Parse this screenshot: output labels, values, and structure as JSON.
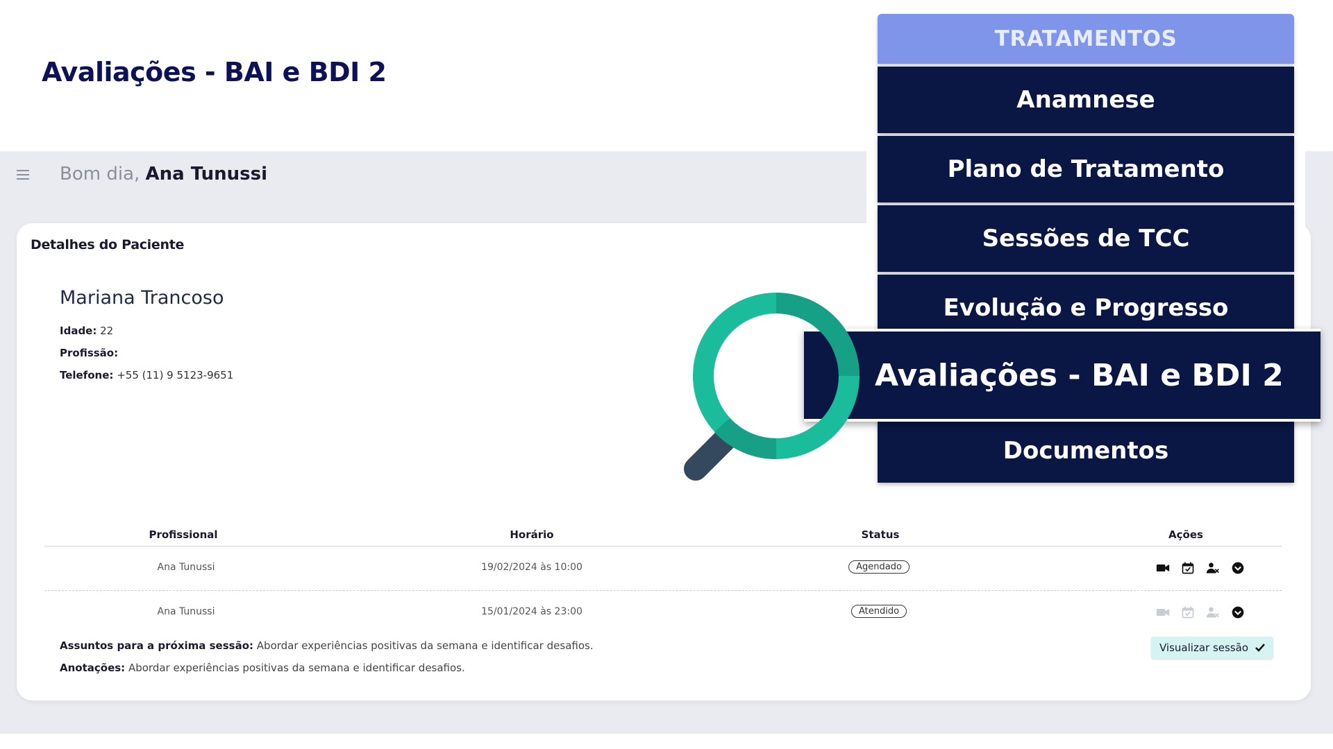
{
  "slide_title": "Avaliações - BAI e BDI 2",
  "header": {
    "greeting": "Bom dia,",
    "user_name": "Ana Tunussi"
  },
  "patient_card": {
    "title": "Detalhes do Paciente",
    "name": "Mariana Trancoso",
    "age_label": "Idade:",
    "age_value": "22",
    "profession_label": "Profissão:",
    "profession_value": "",
    "phone_label": "Telefone:",
    "phone_value": "+55 (11)  9 5123-9651"
  },
  "table": {
    "columns": [
      "Profissional",
      "Horário",
      "Status",
      "Ações"
    ],
    "rows": [
      {
        "professional": "Ana Tunussi",
        "time": "19/02/2024 às 10:00",
        "status": "Agendado",
        "actions_enabled": true
      },
      {
        "professional": "Ana Tunussi",
        "time": "15/01/2024 às 23:00",
        "status": "Atendido",
        "actions_enabled": false
      }
    ]
  },
  "notes": {
    "next_session_label": "Assuntos para a próxima sessão:",
    "next_session_value": "Abordar experiências positivas da semana e identificar desafios.",
    "annotations_label": "Anotações:",
    "annotations_value": "Abordar experiências positivas da semana e identificar desafios."
  },
  "view_session_button": "Visualizar sessão",
  "treatments_menu": {
    "header": "TRATAMENTOS",
    "items": [
      "Anamnese",
      "Plano de Tratamento",
      "Sessões de TCC",
      "Evolução e Progresso",
      "Avaliações - BAI e BDI 2",
      "Documentos"
    ],
    "highlighted_item": "Avaliações - BAI e BDI 2"
  },
  "colors": {
    "title_navy": "#0d1155",
    "menu_navy": "#0a1744",
    "menu_header": "#7f95e9",
    "magnifier_green": "#1abc9c",
    "magnifier_handle": "#34495e",
    "view_button_bg": "#d4f3f1"
  }
}
